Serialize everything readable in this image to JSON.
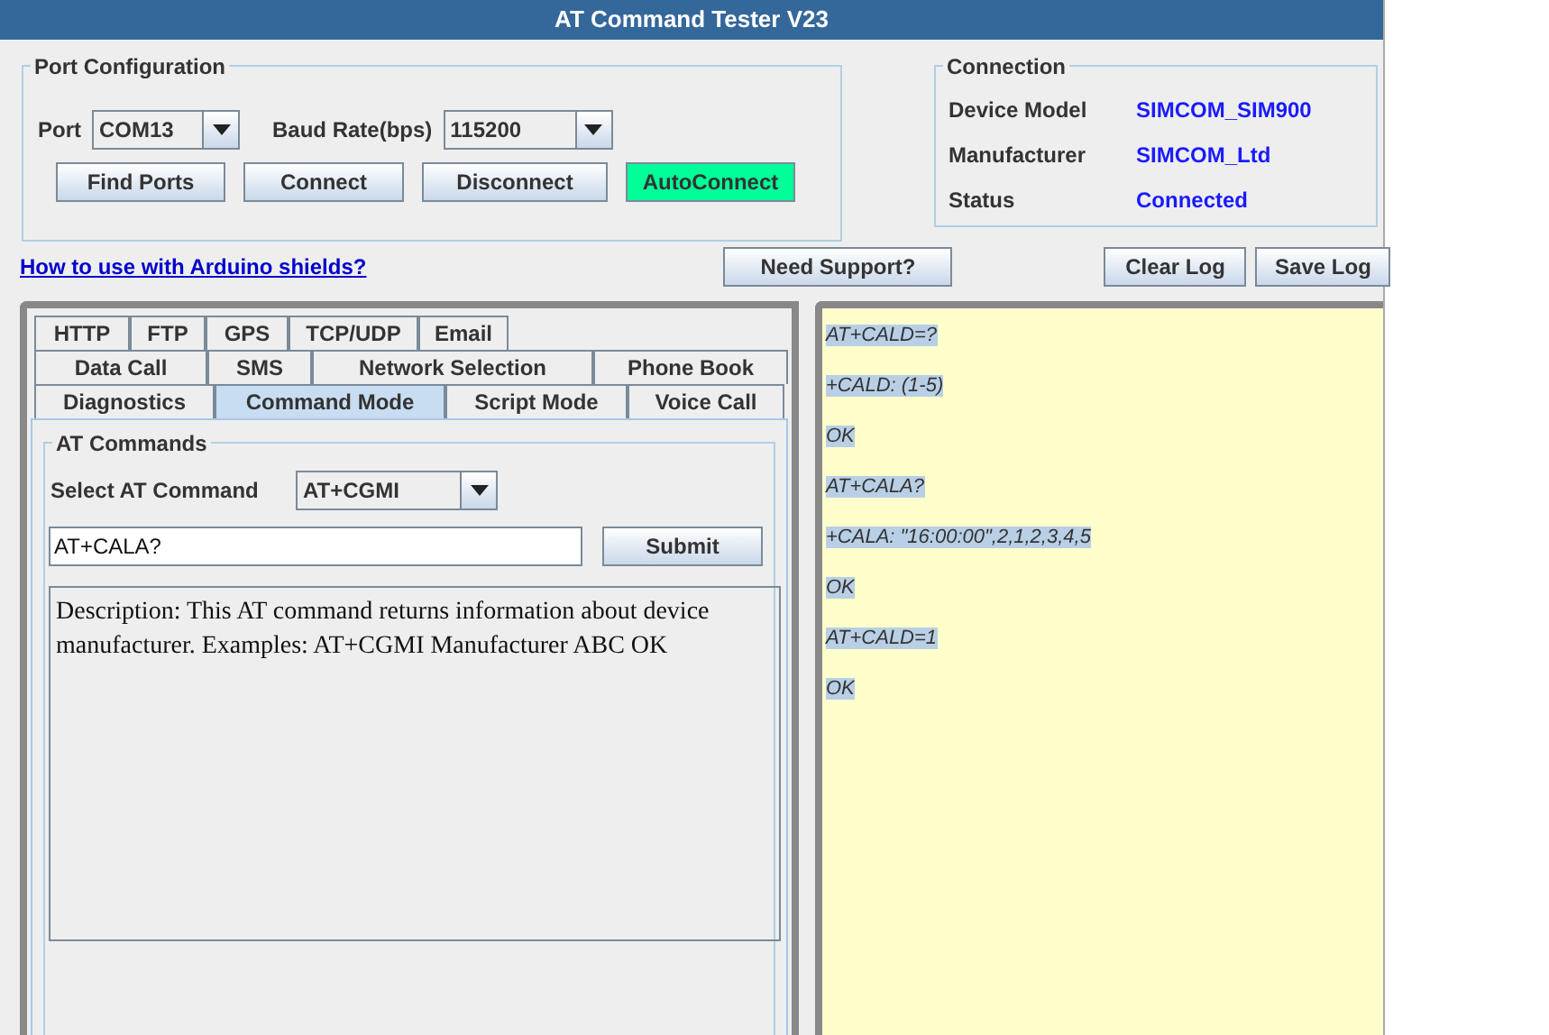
{
  "window": {
    "title": "AT Command Tester V23"
  },
  "port_config": {
    "title": "Port Configuration",
    "port_label": "Port",
    "port_value": "COM13",
    "baud_label": "Baud Rate(bps)",
    "baud_value": "115200",
    "buttons": [
      {
        "label": "Find Ports",
        "kind": "normal"
      },
      {
        "label": "Connect",
        "kind": "normal"
      },
      {
        "label": "Disconnect",
        "kind": "normal"
      },
      {
        "label": "AutoConnect",
        "kind": "highlight"
      }
    ]
  },
  "connection": {
    "title": "Connection",
    "fields": [
      {
        "label": "Device Model",
        "value": "SIMCOM_SIM900"
      },
      {
        "label": "Manufacturer",
        "value": "SIMCOM_Ltd"
      },
      {
        "label": "Status",
        "value": "Connected"
      }
    ]
  },
  "help_link": "How to use with Arduino shields?",
  "support_button": "Need Support?",
  "log_buttons": [
    "Clear Log",
    "Save Log"
  ],
  "tab_rows": [
    [
      {
        "label": "HTTP",
        "selected": false
      },
      {
        "label": "FTP",
        "selected": false
      },
      {
        "label": "GPS",
        "selected": false
      },
      {
        "label": "TCP/UDP",
        "selected": false
      },
      {
        "label": "Email",
        "selected": false
      }
    ],
    [
      {
        "label": "Data Call",
        "selected": false
      },
      {
        "label": "SMS",
        "selected": false
      },
      {
        "label": "Network Selection",
        "selected": false
      },
      {
        "label": "Phone Book",
        "selected": false
      }
    ],
    [
      {
        "label": "Diagnostics",
        "selected": false
      },
      {
        "label": "Command Mode",
        "selected": true
      },
      {
        "label": "Script Mode",
        "selected": false
      },
      {
        "label": "Voice Call",
        "selected": false
      }
    ]
  ],
  "at_commands": {
    "title": "AT Commands",
    "select_label": "Select AT Command",
    "select_value": "AT+CGMI",
    "input_value": "AT+CALA?",
    "submit": "Submit",
    "description": "Description: This AT command returns information about device manufacturer. Examples: AT+CGMI Manufacturer ABC OK"
  },
  "log": [
    "AT+CALD=?",
    "+CALD: (1-5)",
    "OK",
    "AT+CALA?",
    "+CALA: \"16:00:00\",2,1,2,3,4,5",
    "OK",
    "AT+CALD=1",
    "OK"
  ]
}
